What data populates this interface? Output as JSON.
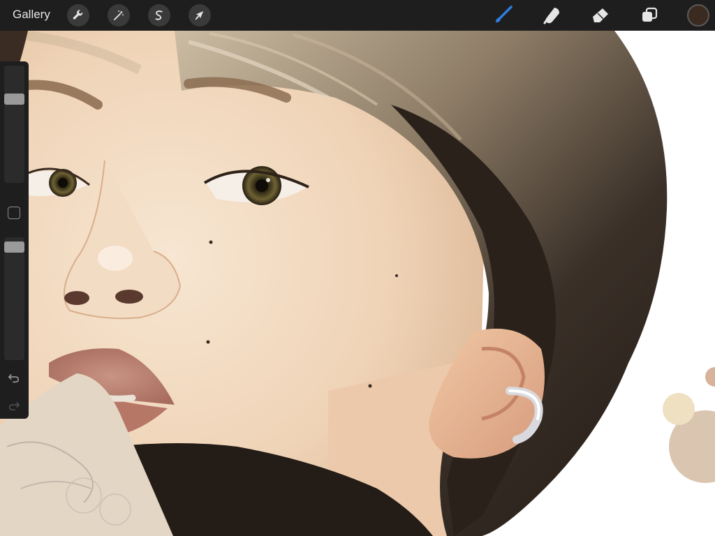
{
  "topbar": {
    "gallery_label": "Gallery",
    "left_tools": [
      {
        "name": "actions",
        "icon": "wrench-icon"
      },
      {
        "name": "adjustments",
        "icon": "magic-wand-icon"
      },
      {
        "name": "selection",
        "icon": "selection-s-icon"
      },
      {
        "name": "transform",
        "icon": "arrow-cursor-icon"
      }
    ],
    "right_tools": [
      {
        "name": "brush",
        "icon": "brush-icon",
        "active": true
      },
      {
        "name": "smudge",
        "icon": "smudge-finger-icon",
        "active": false
      },
      {
        "name": "eraser",
        "icon": "eraser-icon",
        "active": false
      },
      {
        "name": "layers",
        "icon": "layers-icon",
        "active": false
      }
    ],
    "current_color": "#3a2a20",
    "active_tool_color": "#2f7de1"
  },
  "sidebar": {
    "brush_size_level": 0.74,
    "opacity_level": 0.96,
    "icons": [
      "modify-square-icon",
      "undo-icon",
      "redo-icon"
    ]
  },
  "colors": {
    "toolbar_bg": "#1e1e1e",
    "hair_dark": "#2b221b",
    "hair_light": "#b9a98f",
    "skin": "#f0d6bb",
    "jacket": "#231c17"
  }
}
